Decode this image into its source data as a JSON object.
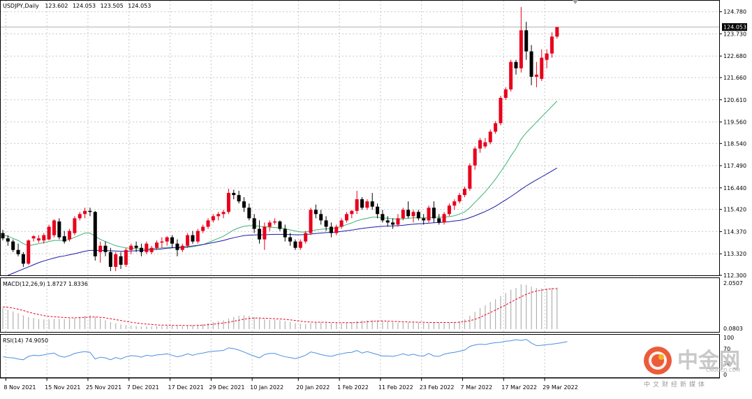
{
  "colors": {
    "up": "#e8001c",
    "down": "#000000",
    "ma_fast": "#3cb371",
    "ma_slow": "#1a1aa6",
    "macd_hist": "#b0b0b0",
    "macd_signal": "#e8001c",
    "rsi": "#4a90e2",
    "grid": "#c8c8c8"
  },
  "main_panel": {
    "header": {
      "symbol": "USDJPY,Daily",
      "open": "123.602",
      "high": "124.053",
      "low": "123.505",
      "close": "124.053"
    },
    "current_price_label": "124.053"
  },
  "macd_panel": {
    "label": "MACD(12,26,9) 1.8727 1.8336",
    "top_label": "2.0507",
    "bottom_label": "0.0803"
  },
  "rsi_panel": {
    "label": "RSI(14) 74.9050",
    "level_labels": [
      "100",
      "70",
      "30",
      "0"
    ]
  },
  "watermark": {
    "name": "中金网",
    "domain": "CNGOLD.COM",
    "subtitle": "中文财经新媒体"
  },
  "chart_data": {
    "type": "candlestick",
    "symbol": "USDJPY",
    "timeframe": "Daily",
    "x_tick_labels": [
      "8 Nov 2021",
      "15 Nov 2021",
      "25 Nov 2021",
      "7 Dec 2021",
      "17 Dec 2021",
      "29 Dec 2021",
      "10 Jan 2022",
      "20 Jan 2022",
      "1 Feb 2022",
      "11 Feb 2022",
      "23 Feb 2022",
      "7 Mar 2022",
      "17 Mar 2022",
      "29 Mar 2022"
    ],
    "y_tick_labels": [
      "124.780",
      "123.730",
      "122.680",
      "121.660",
      "120.610",
      "119.560",
      "118.540",
      "117.490",
      "116.440",
      "115.420",
      "114.370",
      "113.320",
      "112.300"
    ],
    "ylim": [
      112.3,
      125.3
    ],
    "grid": true,
    "candles": [
      {
        "o": 114.3,
        "h": 114.45,
        "l": 113.95,
        "c": 114.05
      },
      {
        "o": 114.05,
        "h": 114.2,
        "l": 113.7,
        "c": 113.9
      },
      {
        "o": 113.9,
        "h": 114.0,
        "l": 113.4,
        "c": 113.5
      },
      {
        "o": 113.5,
        "h": 113.8,
        "l": 113.2,
        "c": 113.3
      },
      {
        "o": 113.3,
        "h": 113.4,
        "l": 112.7,
        "c": 112.85
      },
      {
        "o": 112.85,
        "h": 114.0,
        "l": 112.8,
        "c": 113.95
      },
      {
        "o": 114.05,
        "h": 114.2,
        "l": 113.9,
        "c": 114.15
      },
      {
        "o": 113.95,
        "h": 114.2,
        "l": 113.85,
        "c": 114.05
      },
      {
        "o": 113.95,
        "h": 114.3,
        "l": 113.8,
        "c": 114.2
      },
      {
        "o": 114.0,
        "h": 114.7,
        "l": 113.95,
        "c": 114.6
      },
      {
        "o": 114.2,
        "h": 114.95,
        "l": 114.1,
        "c": 114.9
      },
      {
        "o": 114.85,
        "h": 115.0,
        "l": 114.0,
        "c": 114.1
      },
      {
        "o": 114.15,
        "h": 114.4,
        "l": 113.8,
        "c": 113.9
      },
      {
        "o": 114.0,
        "h": 114.5,
        "l": 113.9,
        "c": 114.4
      },
      {
        "o": 114.3,
        "h": 115.1,
        "l": 114.2,
        "c": 115.0
      },
      {
        "o": 115.0,
        "h": 115.3,
        "l": 114.9,
        "c": 115.2
      },
      {
        "o": 115.2,
        "h": 115.5,
        "l": 115.0,
        "c": 115.35
      },
      {
        "o": 115.35,
        "h": 115.5,
        "l": 115.1,
        "c": 115.3
      },
      {
        "o": 115.3,
        "h": 115.35,
        "l": 113.0,
        "c": 113.2
      },
      {
        "o": 113.4,
        "h": 113.9,
        "l": 112.9,
        "c": 113.7
      },
      {
        "o": 113.7,
        "h": 113.9,
        "l": 113.2,
        "c": 113.4
      },
      {
        "o": 113.4,
        "h": 113.6,
        "l": 112.5,
        "c": 112.7
      },
      {
        "o": 112.7,
        "h": 113.4,
        "l": 112.5,
        "c": 113.3
      },
      {
        "o": 113.2,
        "h": 113.4,
        "l": 112.6,
        "c": 112.8
      },
      {
        "o": 112.8,
        "h": 113.6,
        "l": 112.7,
        "c": 113.5
      },
      {
        "o": 113.5,
        "h": 113.8,
        "l": 113.3,
        "c": 113.7
      },
      {
        "o": 113.7,
        "h": 113.9,
        "l": 113.4,
        "c": 113.6
      },
      {
        "o": 113.6,
        "h": 113.8,
        "l": 113.2,
        "c": 113.4
      },
      {
        "o": 113.4,
        "h": 113.9,
        "l": 113.3,
        "c": 113.8
      },
      {
        "o": 113.4,
        "h": 113.7,
        "l": 113.3,
        "c": 113.6
      },
      {
        "o": 113.6,
        "h": 113.95,
        "l": 113.5,
        "c": 113.85
      },
      {
        "o": 113.85,
        "h": 114.1,
        "l": 113.6,
        "c": 113.9
      },
      {
        "o": 113.9,
        "h": 114.15,
        "l": 113.7,
        "c": 114.1
      },
      {
        "o": 114.1,
        "h": 114.2,
        "l": 113.6,
        "c": 113.8
      },
      {
        "o": 113.8,
        "h": 114.0,
        "l": 113.2,
        "c": 113.5
      },
      {
        "o": 113.5,
        "h": 113.8,
        "l": 113.4,
        "c": 113.7
      },
      {
        "o": 113.7,
        "h": 114.3,
        "l": 113.6,
        "c": 114.2
      },
      {
        "o": 114.2,
        "h": 114.4,
        "l": 113.8,
        "c": 113.9
      },
      {
        "o": 113.9,
        "h": 114.5,
        "l": 113.8,
        "c": 114.4
      },
      {
        "o": 114.4,
        "h": 114.7,
        "l": 114.3,
        "c": 114.6
      },
      {
        "o": 114.6,
        "h": 115.0,
        "l": 114.5,
        "c": 114.9
      },
      {
        "o": 114.9,
        "h": 115.2,
        "l": 114.8,
        "c": 115.1
      },
      {
        "o": 115.1,
        "h": 115.3,
        "l": 114.9,
        "c": 115.2
      },
      {
        "o": 115.2,
        "h": 115.4,
        "l": 115.0,
        "c": 115.3
      },
      {
        "o": 115.3,
        "h": 116.4,
        "l": 115.2,
        "c": 116.2
      },
      {
        "o": 116.2,
        "h": 116.35,
        "l": 115.9,
        "c": 116.1
      },
      {
        "o": 116.1,
        "h": 116.3,
        "l": 115.7,
        "c": 115.8
      },
      {
        "o": 115.8,
        "h": 116.0,
        "l": 115.3,
        "c": 115.5
      },
      {
        "o": 115.5,
        "h": 115.7,
        "l": 114.9,
        "c": 115.0
      },
      {
        "o": 115.0,
        "h": 115.2,
        "l": 114.3,
        "c": 114.5
      },
      {
        "o": 114.5,
        "h": 114.9,
        "l": 113.8,
        "c": 114.0
      },
      {
        "o": 114.0,
        "h": 114.8,
        "l": 113.5,
        "c": 114.6
      },
      {
        "o": 114.6,
        "h": 114.9,
        "l": 114.4,
        "c": 114.8
      },
      {
        "o": 114.8,
        "h": 115.0,
        "l": 114.7,
        "c": 114.85
      },
      {
        "o": 114.85,
        "h": 114.9,
        "l": 114.4,
        "c": 114.5
      },
      {
        "o": 114.5,
        "h": 114.7,
        "l": 113.9,
        "c": 114.1
      },
      {
        "o": 114.1,
        "h": 114.3,
        "l": 113.7,
        "c": 113.9
      },
      {
        "o": 113.9,
        "h": 114.0,
        "l": 113.5,
        "c": 113.6
      },
      {
        "o": 113.6,
        "h": 114.0,
        "l": 113.5,
        "c": 113.9
      },
      {
        "o": 113.9,
        "h": 114.4,
        "l": 113.8,
        "c": 114.3
      },
      {
        "o": 114.3,
        "h": 115.5,
        "l": 114.2,
        "c": 115.4
      },
      {
        "o": 115.4,
        "h": 115.65,
        "l": 115.0,
        "c": 115.2
      },
      {
        "o": 115.2,
        "h": 115.4,
        "l": 114.7,
        "c": 114.9
      },
      {
        "o": 114.9,
        "h": 115.1,
        "l": 114.4,
        "c": 114.6
      },
      {
        "o": 114.6,
        "h": 114.8,
        "l": 114.1,
        "c": 114.3
      },
      {
        "o": 114.3,
        "h": 114.7,
        "l": 114.2,
        "c": 114.6
      },
      {
        "o": 114.6,
        "h": 115.0,
        "l": 114.5,
        "c": 114.9
      },
      {
        "o": 114.9,
        "h": 115.3,
        "l": 114.8,
        "c": 115.2
      },
      {
        "o": 115.2,
        "h": 115.4,
        "l": 115.0,
        "c": 115.35
      },
      {
        "o": 115.35,
        "h": 116.3,
        "l": 115.2,
        "c": 115.9
      },
      {
        "o": 115.9,
        "h": 116.0,
        "l": 115.4,
        "c": 115.5
      },
      {
        "o": 115.5,
        "h": 115.9,
        "l": 115.4,
        "c": 115.8
      },
      {
        "o": 115.8,
        "h": 116.2,
        "l": 115.4,
        "c": 115.55
      },
      {
        "o": 115.55,
        "h": 115.7,
        "l": 115.0,
        "c": 115.2
      },
      {
        "o": 115.2,
        "h": 115.4,
        "l": 114.8,
        "c": 114.9
      },
      {
        "o": 114.9,
        "h": 115.1,
        "l": 114.6,
        "c": 114.8
      },
      {
        "o": 114.8,
        "h": 115.0,
        "l": 114.5,
        "c": 114.7
      },
      {
        "o": 114.7,
        "h": 115.2,
        "l": 114.6,
        "c": 115.0
      },
      {
        "o": 115.0,
        "h": 115.5,
        "l": 114.9,
        "c": 115.4
      },
      {
        "o": 115.4,
        "h": 115.8,
        "l": 115.0,
        "c": 115.1
      },
      {
        "o": 115.1,
        "h": 115.4,
        "l": 114.8,
        "c": 115.3
      },
      {
        "o": 115.3,
        "h": 115.4,
        "l": 114.9,
        "c": 115.0
      },
      {
        "o": 115.0,
        "h": 115.2,
        "l": 114.7,
        "c": 114.9
      },
      {
        "o": 114.9,
        "h": 115.6,
        "l": 114.8,
        "c": 115.5
      },
      {
        "o": 115.5,
        "h": 115.8,
        "l": 114.8,
        "c": 115.0
      },
      {
        "o": 115.0,
        "h": 115.2,
        "l": 114.7,
        "c": 114.8
      },
      {
        "o": 114.8,
        "h": 115.3,
        "l": 114.7,
        "c": 115.2
      },
      {
        "o": 115.2,
        "h": 115.7,
        "l": 115.1,
        "c": 115.6
      },
      {
        "o": 115.6,
        "h": 115.9,
        "l": 115.4,
        "c": 115.8
      },
      {
        "o": 115.8,
        "h": 116.2,
        "l": 115.7,
        "c": 116.1
      },
      {
        "o": 116.1,
        "h": 116.5,
        "l": 116.0,
        "c": 116.4
      },
      {
        "o": 116.4,
        "h": 117.6,
        "l": 116.3,
        "c": 117.5
      },
      {
        "o": 117.5,
        "h": 118.4,
        "l": 117.3,
        "c": 118.3
      },
      {
        "o": 118.3,
        "h": 118.8,
        "l": 118.1,
        "c": 118.7
      },
      {
        "o": 118.4,
        "h": 118.8,
        "l": 118.3,
        "c": 118.6
      },
      {
        "o": 118.6,
        "h": 119.2,
        "l": 118.5,
        "c": 119.1
      },
      {
        "o": 119.1,
        "h": 119.6,
        "l": 119.0,
        "c": 119.5
      },
      {
        "o": 119.5,
        "h": 120.8,
        "l": 119.4,
        "c": 120.7
      },
      {
        "o": 120.7,
        "h": 121.2,
        "l": 120.6,
        "c": 121.1
      },
      {
        "o": 121.1,
        "h": 122.5,
        "l": 121.0,
        "c": 122.4
      },
      {
        "o": 122.4,
        "h": 122.5,
        "l": 121.8,
        "c": 122.1
      },
      {
        "o": 122.1,
        "h": 125.0,
        "l": 121.9,
        "c": 123.9
      },
      {
        "o": 123.9,
        "h": 124.3,
        "l": 122.5,
        "c": 122.9
      },
      {
        "o": 122.9,
        "h": 123.2,
        "l": 121.3,
        "c": 121.7
      },
      {
        "o": 121.7,
        "h": 122.4,
        "l": 121.2,
        "c": 121.8
      },
      {
        "o": 121.6,
        "h": 123.0,
        "l": 121.5,
        "c": 122.6
      },
      {
        "o": 122.5,
        "h": 123.0,
        "l": 122.1,
        "c": 122.8
      },
      {
        "o": 122.8,
        "h": 123.8,
        "l": 122.6,
        "c": 123.6
      },
      {
        "o": 123.602,
        "h": 124.053,
        "l": 123.505,
        "c": 124.053
      }
    ],
    "series": [
      {
        "values": [
          114.2,
          114.15,
          114.05,
          113.95,
          113.8,
          113.7,
          113.75,
          113.8,
          113.85,
          113.9,
          113.95,
          113.95,
          113.95,
          114.0,
          114.1,
          114.2,
          114.3,
          114.3,
          114.15,
          114.0,
          113.9,
          113.8,
          113.7,
          113.65,
          113.6,
          113.58,
          113.56,
          113.54,
          113.55,
          113.56,
          113.58,
          113.6,
          113.62,
          113.62,
          113.6,
          113.6,
          113.62,
          113.65,
          113.7,
          113.75,
          113.85,
          113.95,
          114.05,
          114.15,
          114.3,
          114.45,
          114.55,
          114.62,
          114.65,
          114.65,
          114.62,
          114.6,
          114.58,
          114.56,
          114.55,
          114.5,
          114.45,
          114.4,
          114.35,
          114.35,
          114.4,
          114.45,
          114.48,
          114.5,
          114.5,
          114.55,
          114.62,
          114.7,
          114.78,
          114.88,
          114.95,
          115.0,
          115.05,
          115.05,
          115.02,
          115.0,
          114.98,
          114.96,
          114.98,
          115.0,
          115.02,
          115.03,
          115.02,
          115.02,
          115.05,
          115.05,
          115.05,
          115.08,
          115.12,
          115.2,
          115.3,
          115.5,
          115.75,
          116.0,
          116.25,
          116.55,
          116.85,
          117.2,
          117.55,
          117.95,
          118.3,
          118.75,
          119.05,
          119.3,
          119.55,
          119.8,
          120.05,
          120.3,
          120.55
        ]
      },
      {
        "values": [
          112.2,
          112.3,
          112.4,
          112.5,
          112.6,
          112.7,
          112.8,
          112.9,
          112.98,
          113.05,
          113.12,
          113.18,
          113.22,
          113.27,
          113.32,
          113.38,
          113.44,
          113.48,
          113.48,
          113.48,
          113.47,
          113.46,
          113.45,
          113.44,
          113.44,
          113.45,
          113.46,
          113.47,
          113.49,
          113.51,
          113.53,
          113.55,
          113.58,
          113.6,
          113.62,
          113.64,
          113.66,
          113.69,
          113.72,
          113.76,
          113.8,
          113.85,
          113.9,
          113.95,
          114.02,
          114.08,
          114.13,
          114.18,
          114.2,
          114.21,
          114.22,
          114.22,
          114.23,
          114.24,
          114.24,
          114.24,
          114.23,
          114.22,
          114.22,
          114.23,
          114.25,
          114.28,
          114.3,
          114.32,
          114.33,
          114.35,
          114.38,
          114.41,
          114.44,
          114.48,
          114.52,
          114.55,
          114.58,
          114.6,
          114.62,
          114.63,
          114.64,
          114.65,
          114.67,
          114.7,
          114.72,
          114.74,
          114.75,
          114.77,
          114.79,
          114.8,
          114.82,
          114.84,
          114.87,
          114.9,
          114.95,
          115.03,
          115.12,
          115.22,
          115.32,
          115.44,
          115.57,
          115.72,
          115.87,
          116.03,
          116.19,
          116.37,
          116.53,
          116.68,
          116.82,
          116.96,
          117.1,
          117.24,
          117.38
        ]
      }
    ],
    "macd_hist": [
      0.95,
      0.88,
      0.8,
      0.72,
      0.62,
      0.55,
      0.5,
      0.46,
      0.44,
      0.44,
      0.46,
      0.46,
      0.45,
      0.46,
      0.5,
      0.55,
      0.6,
      0.63,
      0.55,
      0.47,
      0.4,
      0.32,
      0.26,
      0.21,
      0.18,
      0.16,
      0.14,
      0.12,
      0.12,
      0.12,
      0.13,
      0.14,
      0.16,
      0.16,
      0.15,
      0.14,
      0.15,
      0.17,
      0.2,
      0.23,
      0.27,
      0.32,
      0.36,
      0.4,
      0.48,
      0.55,
      0.6,
      0.62,
      0.6,
      0.55,
      0.48,
      0.44,
      0.42,
      0.42,
      0.4,
      0.36,
      0.32,
      0.27,
      0.24,
      0.23,
      0.27,
      0.29,
      0.3,
      0.29,
      0.27,
      0.26,
      0.27,
      0.29,
      0.32,
      0.36,
      0.39,
      0.4,
      0.41,
      0.4,
      0.37,
      0.34,
      0.31,
      0.29,
      0.29,
      0.3,
      0.31,
      0.3,
      0.28,
      0.27,
      0.29,
      0.29,
      0.27,
      0.28,
      0.32,
      0.37,
      0.44,
      0.6,
      0.78,
      0.95,
      1.08,
      1.22,
      1.35,
      1.5,
      1.63,
      1.78,
      1.86,
      2.02,
      2.0,
      1.92,
      1.86,
      1.84,
      1.84,
      1.86,
      1.87
    ],
    "macd_signal": [
      1.0,
      0.99,
      0.95,
      0.9,
      0.84,
      0.77,
      0.71,
      0.66,
      0.61,
      0.58,
      0.56,
      0.54,
      0.52,
      0.51,
      0.51,
      0.52,
      0.53,
      0.55,
      0.55,
      0.53,
      0.51,
      0.47,
      0.43,
      0.39,
      0.35,
      0.31,
      0.28,
      0.25,
      0.23,
      0.21,
      0.19,
      0.18,
      0.18,
      0.17,
      0.17,
      0.17,
      0.16,
      0.16,
      0.17,
      0.18,
      0.2,
      0.22,
      0.25,
      0.28,
      0.31,
      0.36,
      0.4,
      0.45,
      0.48,
      0.5,
      0.5,
      0.49,
      0.48,
      0.47,
      0.46,
      0.44,
      0.42,
      0.39,
      0.36,
      0.33,
      0.32,
      0.31,
      0.31,
      0.31,
      0.3,
      0.29,
      0.29,
      0.29,
      0.29,
      0.3,
      0.31,
      0.33,
      0.35,
      0.36,
      0.37,
      0.36,
      0.35,
      0.34,
      0.33,
      0.32,
      0.32,
      0.31,
      0.31,
      0.3,
      0.3,
      0.3,
      0.3,
      0.3,
      0.3,
      0.31,
      0.34,
      0.38,
      0.44,
      0.53,
      0.64,
      0.75,
      0.86,
      0.98,
      1.09,
      1.22,
      1.34,
      1.46,
      1.57,
      1.66,
      1.72,
      1.76,
      1.8,
      1.82,
      1.83
    ],
    "rsi": [
      48,
      46,
      45,
      42,
      40,
      49,
      52,
      51,
      53,
      56,
      58,
      50,
      47,
      51,
      57,
      60,
      62,
      60,
      42,
      47,
      45,
      40,
      46,
      42,
      48,
      51,
      50,
      47,
      52,
      50,
      53,
      54,
      56,
      52,
      48,
      51,
      56,
      52,
      56,
      58,
      61,
      63,
      64,
      65,
      72,
      70,
      66,
      61,
      55,
      50,
      45,
      54,
      57,
      57,
      52,
      48,
      46,
      43,
      47,
      52,
      61,
      58,
      54,
      51,
      49,
      53,
      56,
      59,
      60,
      65,
      58,
      62,
      58,
      54,
      50,
      50,
      49,
      52,
      56,
      52,
      55,
      51,
      50,
      57,
      50,
      49,
      55,
      58,
      60,
      63,
      66,
      76,
      80,
      82,
      81,
      84,
      86,
      87,
      90,
      91,
      94,
      92,
      95,
      85,
      78,
      79,
      81,
      82,
      84,
      86,
      89
    ]
  }
}
